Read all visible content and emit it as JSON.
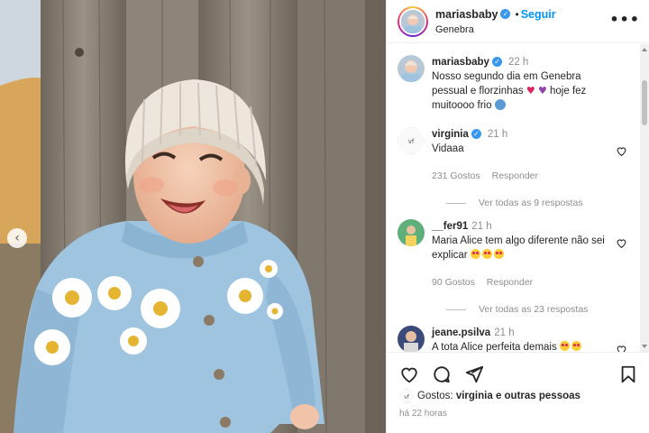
{
  "post": {
    "username": "mariasbaby",
    "follow_label": "Seguir",
    "separator": "•",
    "location": "Genebra",
    "more_label": "•••"
  },
  "caption": {
    "username": "mariasbaby",
    "time": "22 h",
    "text_line1": "Nosso segundo dia em Genebra",
    "text_line2": "pessual e florzinhas",
    "text_line3": "hoje fez",
    "text_line4": "muitoooo frio"
  },
  "comments": [
    {
      "username": "virginia",
      "time": "21 h",
      "text": "Vidaaa",
      "likes": "231 Gostos",
      "reply": "Responder",
      "view_replies": "Ver todas as 9 respostas"
    },
    {
      "username": "__fer91",
      "time": "21 h",
      "text": "Maria Alice tem algo diferente não sei explicar",
      "likes": "90 Gostos",
      "reply": "Responder",
      "view_replies": "Ver todas as 23 respostas"
    },
    {
      "username": "jeane.psilva",
      "time": "21 h",
      "text": "A tota Alice perfeita demais"
    }
  ],
  "likes_row": {
    "prefix": "Gostos:",
    "who": "virginia e outras pessoas"
  },
  "time_ago": "há 22 horas",
  "icons": [
    "chevron-left-icon",
    "heart-icon",
    "comment-icon",
    "share-icon",
    "bookmark-icon",
    "more-icon",
    "verified-icon"
  ],
  "colors": {
    "accent": "#0095f6",
    "verified": "#3897f0",
    "muted": "#8e8e8e",
    "sweater": "#9fc4e0",
    "hat": "#ece6dc"
  }
}
